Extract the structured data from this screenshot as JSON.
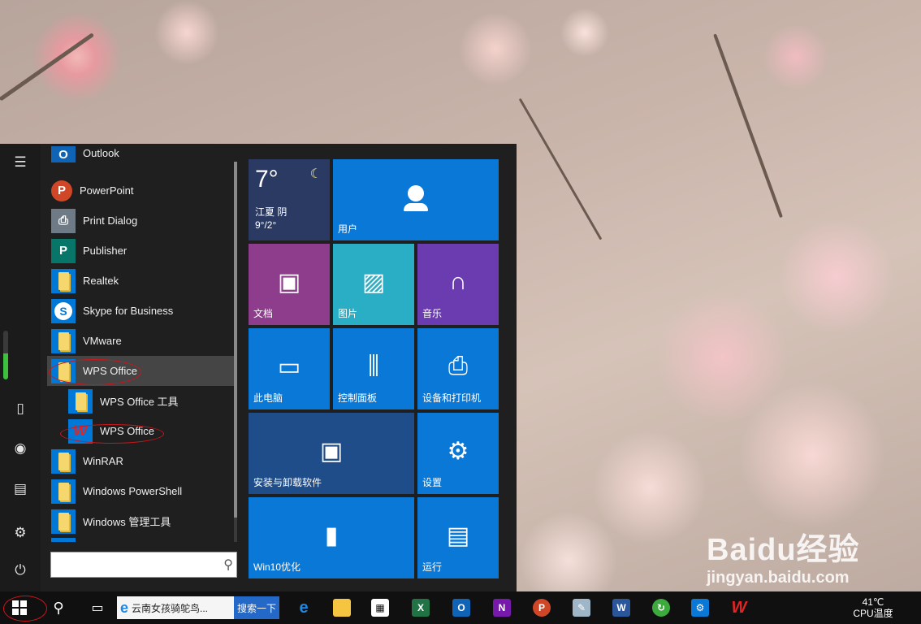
{
  "start_menu": {
    "apps": [
      {
        "label": "Outlook",
        "icon": "outlook-icon",
        "color": "#0f64b5",
        "letter": "O"
      },
      {
        "label": "PowerPoint",
        "icon": "powerpoint-icon",
        "color": "#d04727",
        "letter": "P"
      },
      {
        "label": "Print Dialog",
        "icon": "printer-icon",
        "color": "#6e7a86",
        "letter": "⎙"
      },
      {
        "label": "Publisher",
        "icon": "publisher-icon",
        "color": "#077568",
        "letter": "P"
      },
      {
        "label": "Realtek",
        "icon": "folder-icon",
        "color": "#0078d7",
        "letter": ""
      },
      {
        "label": "Skype for Business",
        "icon": "skype-icon",
        "color": "#0078d7",
        "letter": "S"
      },
      {
        "label": "VMware",
        "icon": "folder-icon",
        "color": "#0078d7",
        "letter": ""
      },
      {
        "label": "WPS Office",
        "icon": "folder-icon",
        "color": "#0078d7",
        "letter": ""
      },
      {
        "label": "WPS Office 工具",
        "icon": "folder-icon",
        "color": "#0078d7",
        "letter": ""
      },
      {
        "label": "WPS Office",
        "icon": "wps-icon",
        "color": "#0078d7",
        "letter": "W"
      },
      {
        "label": "WinRAR",
        "icon": "folder-icon",
        "color": "#0078d7",
        "letter": ""
      },
      {
        "label": "Windows PowerShell",
        "icon": "folder-icon",
        "color": "#0078d7",
        "letter": ""
      },
      {
        "label": "Windows 管理工具",
        "icon": "folder-icon",
        "color": "#0078d7",
        "letter": ""
      }
    ],
    "selected_app": "WPS Office",
    "search_placeholder": ""
  },
  "weather_tile": {
    "temp": "7°",
    "location": "江夏 阴",
    "range": "9°/2°"
  },
  "tiles": {
    "user": "用户",
    "docs": "文档",
    "pictures": "图片",
    "music": "音乐",
    "this_pc": "此电脑",
    "control_panel": "控制面板",
    "devices_printers": "设备和打印机",
    "install_uninstall": "安装与卸载软件",
    "settings": "设置",
    "win10": "Win10优化",
    "run": "运行"
  },
  "tile_colors": {
    "blue": "#0a78d7",
    "purple_docs": "#8e3c8c",
    "teal_pictures": "#2aaec6",
    "violet_music": "#6a3cb0",
    "dark_blue": "#1f4d8a",
    "weather": "#2b3a63"
  },
  "taskbar": {
    "ie_search_text": "云南女孩骑鸵鸟...",
    "ie_search_button": "搜索一下",
    "temperature": "41℃",
    "temperature_label": "CPU温度"
  },
  "watermark": {
    "brand": "Baidu经验",
    "url": "jingyan.baidu.com"
  }
}
